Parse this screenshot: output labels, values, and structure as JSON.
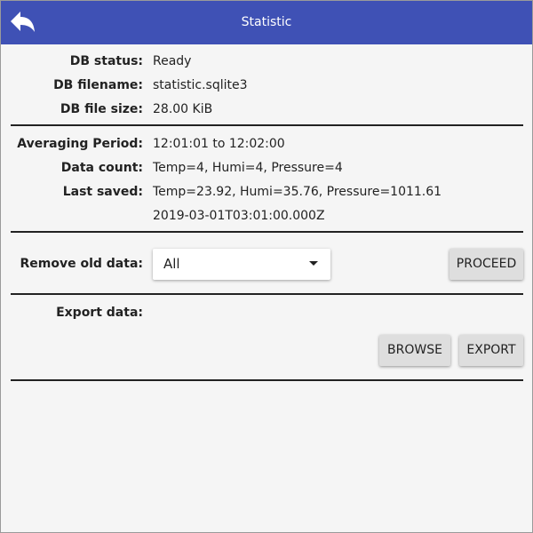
{
  "header": {
    "title": "Statistic",
    "back_icon": "back-arrow-icon",
    "background": "#3f51b5"
  },
  "db": {
    "status_label": "DB status:",
    "status_value": "Ready",
    "filename_label": "DB filename:",
    "filename_value": "statistic.sqlite3",
    "size_label": "DB file size:",
    "size_value": "28.00 KiB"
  },
  "stats": {
    "period_label": "Averaging Period:",
    "period_value": "12:01:01 to 12:02:00",
    "count_label": "Data count:",
    "count_value": "Temp=4, Humi=4, Pressure=4",
    "saved_label": "Last saved:",
    "saved_value": "Temp=23.92, Humi=35.76, Pressure=1011.61",
    "saved_timestamp": "2019-03-01T03:01:00.000Z"
  },
  "remove": {
    "label": "Remove old data:",
    "selected": "All",
    "proceed_label": "PROCEED"
  },
  "export": {
    "label": "Export data:",
    "browse_label": "BROWSE",
    "export_label": "EXPORT"
  }
}
